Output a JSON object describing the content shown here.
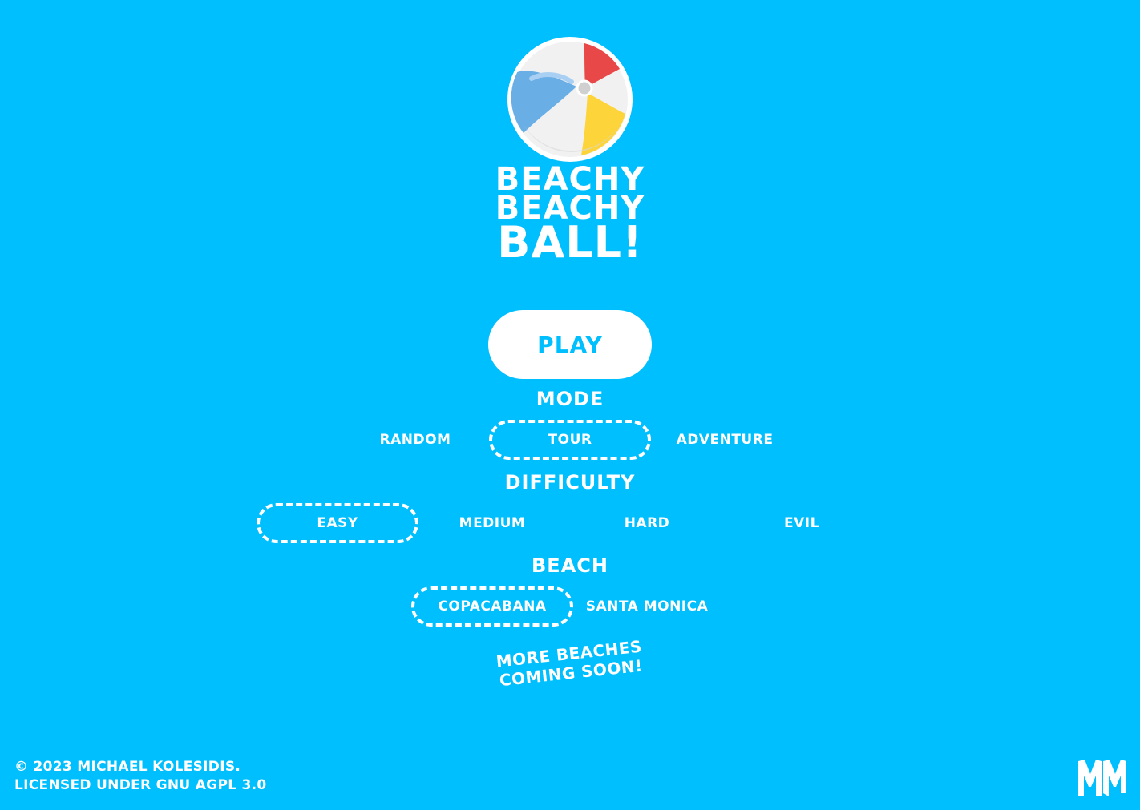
{
  "logo": {
    "title_line1": "BEACHY",
    "title_line2": "BEACHY",
    "title_line3": "BALL!",
    "icon": "beach-ball-icon"
  },
  "play_button": {
    "label": "PLAY"
  },
  "mode": {
    "title": "MODE",
    "options": [
      {
        "label": "RANDOM",
        "selected": false
      },
      {
        "label": "TOUR",
        "selected": true
      },
      {
        "label": "ADVENTURE",
        "selected": false
      }
    ]
  },
  "difficulty": {
    "title": "DIFFICULTY",
    "options": [
      {
        "label": "EASY",
        "selected": true
      },
      {
        "label": "MEDIUM",
        "selected": false
      },
      {
        "label": "HARD",
        "selected": false
      },
      {
        "label": "EVIL",
        "selected": false
      }
    ]
  },
  "beach": {
    "title": "BEACH",
    "options": [
      {
        "label": "COPACABANA",
        "selected": true
      },
      {
        "label": "SANTA MONICA",
        "selected": false
      }
    ],
    "note_line1": "MORE BEACHES",
    "note_line2": "COMING SOON!"
  },
  "footer": {
    "copyright": "© 2023 MICHAEL KOLESIDIS.",
    "license": "LICENSED UNDER GNU AGPL 3.0",
    "author_logo_icon": "mm-logo-icon"
  },
  "colors": {
    "background": "#00bfff",
    "foreground": "#ffffff",
    "ball_red": "#e94848",
    "ball_yellow": "#fdd43a",
    "ball_blue": "#6aaee6"
  }
}
